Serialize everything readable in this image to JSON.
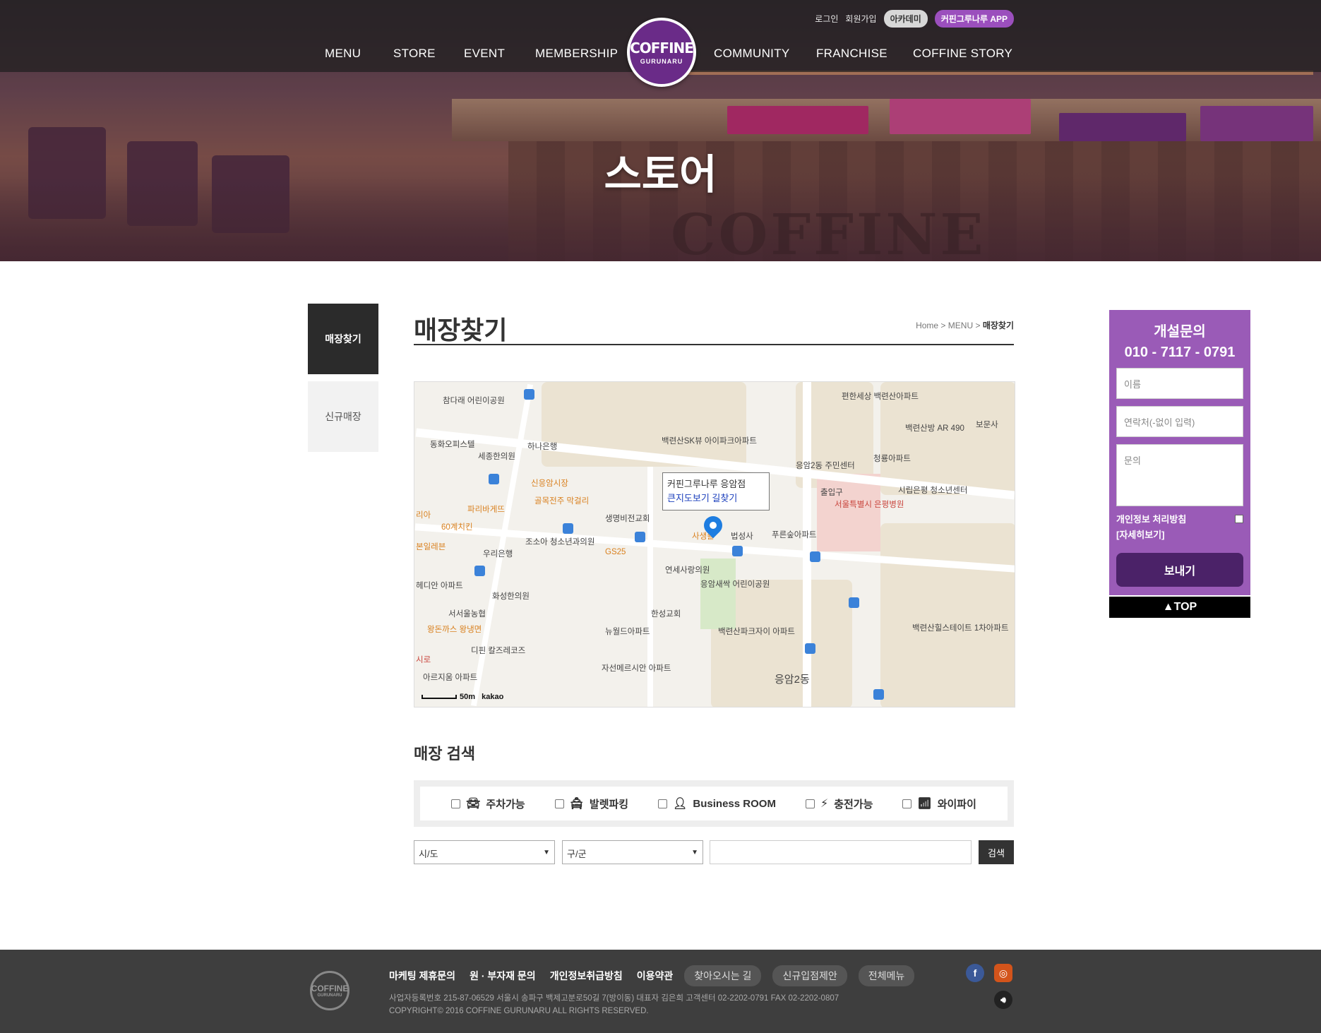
{
  "header": {
    "util_links": [
      "로그인",
      "회원가입"
    ],
    "academy_label": "아카데미",
    "app_label": "커핀그루나루 APP",
    "logo_line1": "COFFINE",
    "logo_line2": "GURUNARU",
    "nav": [
      "MENU",
      "STORE",
      "EVENT",
      "MEMBERSHIP",
      "COMMUNITY",
      "FRANCHISE",
      "COFFINE STORY"
    ],
    "hero_title": "스토어",
    "hero_wall_text": "COFFINE"
  },
  "side_nav": {
    "items": [
      {
        "label": "매장찾기",
        "active": true
      },
      {
        "label": "신규매장",
        "active": false
      }
    ]
  },
  "content": {
    "page_title": "매장찾기",
    "breadcrumb": {
      "home": "Home",
      "sep": ">",
      "menu": "MENU",
      "current": "매장찾기"
    },
    "map": {
      "info_store": "커핀그루나루 응암점",
      "info_links": "큰지도보기 길찾기",
      "scale_label": "50m",
      "provider": "kakao",
      "labels": [
        "참다래 어린이공원",
        "동화오피스텔",
        "세종한의원",
        "하나은행",
        "백련산SK뷰 아이파크아파트",
        "응암2동 주민센터",
        "편한세상 백련산아파트",
        "백련산방 AR 490",
        "보문사",
        "청룡아파트",
        "신응암시장",
        "골목전주 막걸리",
        "파리바게뜨",
        "60계치킨",
        "생명비전교회",
        "조소아 청소년과의원",
        "우리은행",
        "GS25",
        "사생활",
        "법성사",
        "푸른숲아파트",
        "시립은평 청소년센터",
        "서울특별시 은평병원",
        "연세사랑의원",
        "응암새싹 어린이공원",
        "한성교회",
        "화성한의원",
        "서서울농협",
        "왕돈까스 왕냉면",
        "디핀 칼즈레코즈",
        "뉴월드아파트",
        "백련산파크자이 아파트",
        "자선메르시안 아파트",
        "아르지움 아파트",
        "백련산힐스테이트 1차아파트",
        "응암2동",
        "출입구",
        "시로",
        "본일레븐",
        "헤디안 아파트",
        "리아"
      ]
    },
    "search": {
      "title": "매장 검색",
      "options": [
        {
          "label": "주차가능",
          "icon": "car-icon"
        },
        {
          "label": "발렛파킹",
          "icon": "valet-icon"
        },
        {
          "label": "Business ROOM",
          "icon": "person-icon"
        },
        {
          "label": "충전가능",
          "icon": "plug-icon"
        },
        {
          "label": "와이파이",
          "icon": "wifi-icon"
        }
      ],
      "sido_selected": "시/도",
      "gugun_selected": "구/군",
      "keyword_value": "",
      "button_label": "검색"
    }
  },
  "inquiry": {
    "title": "개설문의",
    "phone": "010 - 7117 - 0791",
    "name_placeholder": "이름",
    "contact_placeholder": "연락처(-없이 입력)",
    "message_placeholder": "문의",
    "privacy_label": "개인정보 처리방침",
    "privacy_more": "[자세히보기]",
    "send_label": "보내기",
    "top_label": "▲TOP"
  },
  "footer": {
    "logo_line1": "COFFINE",
    "logo_line2": "GURUNARU",
    "links": [
      "마케팅 제휴문의",
      "원 · 부자재 문의",
      "개인정보취급방침",
      "이용약관"
    ],
    "pills": [
      "찾아오시는 길",
      "신규입점제안",
      "전체메뉴"
    ],
    "info_line": "사업자등록번호 215-87-06529 서울시 송파구 백제고분로50길 7(방이동) 대표자 김은희    고객센터 02-2202-0791 FAX 02-2202-0807",
    "copyright": "COPYRIGHT© 2016 COFFINE GURUNARU ALL RIGHTS RESERVED.",
    "colors": {
      "facebook": "#3b5998",
      "instagram": "#d3541b",
      "sound": "#222222"
    }
  },
  "colors": {
    "brand_purple": "#6a2b88",
    "float_purple": "#9a5bb7",
    "send_purple": "#4b2268"
  }
}
